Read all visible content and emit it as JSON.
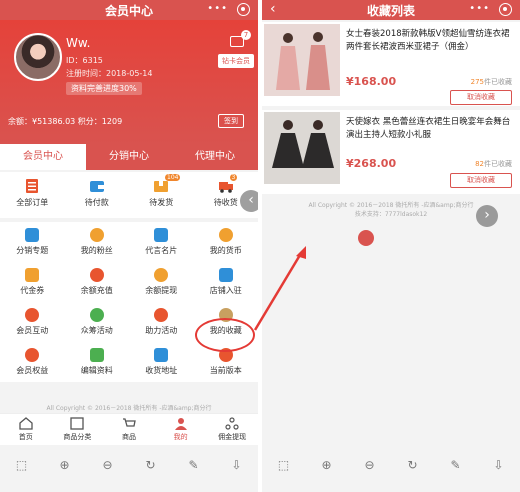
{
  "left": {
    "title": "会员中心",
    "nav_more": "•••",
    "profile": {
      "name": "Ww.",
      "id": "ID：6315",
      "register": "注册时间：2018-05-14",
      "progress": "资料完善进度30%",
      "message_count": "7",
      "vip_button": "钻卡会员",
      "balance": "余额：¥51386.03  积分：1209",
      "sign_button": "签到"
    },
    "tabs": [
      "会员中心",
      "分销中心",
      "代理中心"
    ],
    "orders": [
      {
        "label": "全部订单",
        "icon": "list-icon",
        "badge": ""
      },
      {
        "label": "待付款",
        "icon": "wallet-icon",
        "badge": ""
      },
      {
        "label": "待发货",
        "icon": "box-icon",
        "badge": "104"
      },
      {
        "label": "待收货",
        "icon": "truck-icon",
        "badge": "3"
      }
    ],
    "grid": [
      {
        "label": "分销专题",
        "icon": "topic-icon",
        "color": "#2f8fd8"
      },
      {
        "label": "我的粉丝",
        "icon": "fans-icon",
        "color": "#f0a030"
      },
      {
        "label": "代言名片",
        "icon": "card-icon",
        "color": "#2f8fd8"
      },
      {
        "label": "我的货币",
        "icon": "coin-icon",
        "color": "#f0a030"
      },
      {
        "label": "代金券",
        "icon": "coupon-icon",
        "color": "#f0a030"
      },
      {
        "label": "余额充值",
        "icon": "recharge-icon",
        "color": "#e8552f"
      },
      {
        "label": "余额提现",
        "icon": "withdraw-icon",
        "color": "#f0a030"
      },
      {
        "label": "店铺入驻",
        "icon": "shop-icon",
        "color": "#2f8fd8"
      },
      {
        "label": "会员互动",
        "icon": "interact-icon",
        "color": "#e8552f"
      },
      {
        "label": "众筹活动",
        "icon": "crowd-icon",
        "color": "#4caf50"
      },
      {
        "label": "助力活动",
        "icon": "boost-icon",
        "color": "#e8552f"
      },
      {
        "label": "我的收藏",
        "icon": "favorite-icon",
        "color": "#c8a060"
      },
      {
        "label": "会员权益",
        "icon": "rights-icon",
        "color": "#e8552f"
      },
      {
        "label": "编辑资料",
        "icon": "edit-icon",
        "color": "#4caf50"
      },
      {
        "label": "收货地址",
        "icon": "address-icon",
        "color": "#2f8fd8"
      },
      {
        "label": "当前版本",
        "icon": "version-icon",
        "color": "#e8552f"
      }
    ],
    "copyright": "All Copyright © 2016－2018 微托所有 -应酒&amp;商分行",
    "tabbar": [
      {
        "label": "首页",
        "icon": "home-icon"
      },
      {
        "label": "商品分类",
        "icon": "category-icon"
      },
      {
        "label": "商品",
        "icon": "cart-icon"
      },
      {
        "label": "我的",
        "icon": "user-icon"
      },
      {
        "label": "佣金提现",
        "icon": "commission-icon"
      }
    ],
    "tools": [
      "⬚",
      "⊕",
      "⊖",
      "↻",
      "✎",
      "⇩"
    ]
  },
  "right": {
    "title": "收藏列表",
    "nav_back": "‹",
    "nav_more": "•••",
    "items": [
      {
        "name": "女士春装2018新款韩版V领超仙雪纺连衣裙两件套长裙波西米亚裙子（佣金）",
        "price": "¥168.00",
        "fav": "275",
        "fav_suffix": "件已收藏",
        "cancel": "取消收藏"
      },
      {
        "name": "天使嫁衣 黑色蕾丝连衣裙生日晚宴年会舞台演出主持人短款小礼服",
        "price": "¥268.00",
        "fav": "82",
        "fav_suffix": "件已收藏",
        "cancel": "取消收藏"
      }
    ],
    "copyright": "All Copyright © 2016－2018 微托所有 -应酒&amp;商分行",
    "tech_support": "技术支持：7777ldasok12",
    "tools": [
      "⬚",
      "⊕",
      "⊖",
      "↻",
      "✎",
      "⇩"
    ]
  },
  "accent": "#d9534f"
}
